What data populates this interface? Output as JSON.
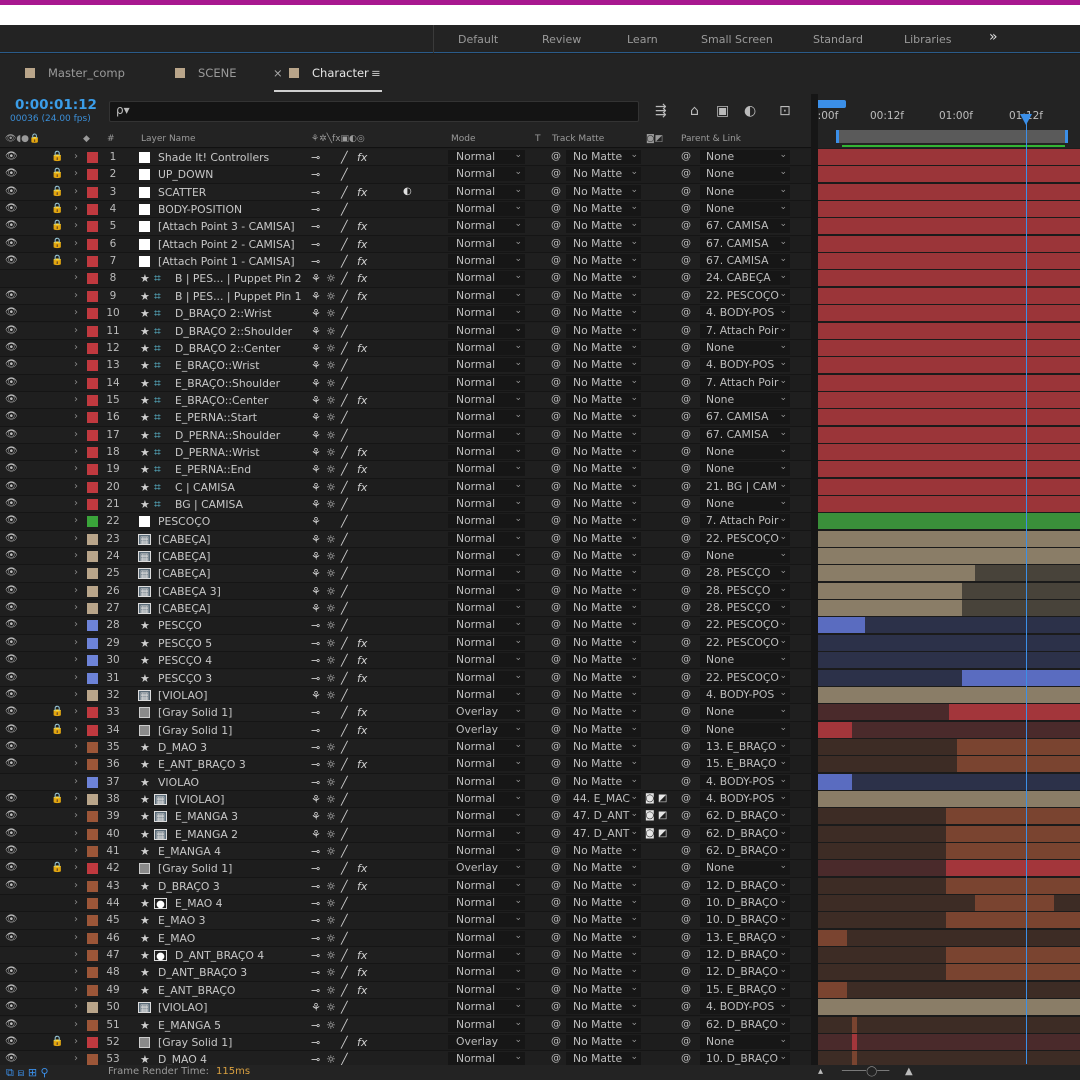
{
  "workspace": {
    "items": [
      "Default",
      "Review",
      "Learn",
      "Small Screen",
      "Standard",
      "Libraries"
    ],
    "more": "»"
  },
  "tabs": {
    "items": [
      "Master_comp",
      "SCENE",
      "Character"
    ],
    "close": "×",
    "menu": "≡"
  },
  "timeline": {
    "timecode": "0:00:01:12",
    "frames": "00036 (24.00 fps)",
    "search_icon": "ρ▾",
    "ruler": [
      "0:00f",
      "00:12f",
      "01:00f",
      "01:12f"
    ]
  },
  "headers": {
    "layer_name": "Layer Name",
    "mode": "Mode",
    "t": "T",
    "track_matte": "Track Matte",
    "parent": "Parent & Link",
    "num": "#"
  },
  "colors": {
    "red": "#c0393f",
    "green": "#3aa43a",
    "tan": "#b9a58a",
    "blue": "#6d83d8",
    "brown": "#9c5638",
    "gray": "#8a8a8a"
  },
  "layers": [
    {
      "n": "1",
      "name": "Shade It! Controllers",
      "src": "white",
      "lock": true,
      "label": "red",
      "fx": true,
      "mode": "Normal",
      "matte": "No Matte",
      "parent": "None"
    },
    {
      "n": "2",
      "name": "UP_DOWN",
      "src": "white",
      "lock": true,
      "label": "red",
      "fx": false,
      "mode": "Normal",
      "matte": "No Matte",
      "parent": "None"
    },
    {
      "n": "3",
      "name": "SCATTER",
      "src": "white",
      "lock": true,
      "label": "red",
      "fx": true,
      "mb": true,
      "mode": "Normal",
      "matte": "No Matte",
      "parent": "None"
    },
    {
      "n": "4",
      "name": "BODY-POSITION",
      "src": "white",
      "lock": true,
      "label": "red",
      "fx": false,
      "mode": "Normal",
      "matte": "No Matte",
      "parent": "None"
    },
    {
      "n": "5",
      "name": "[Attach Point 3 - CAMISA]",
      "src": "white",
      "lock": true,
      "label": "red",
      "fx": true,
      "mode": "Normal",
      "matte": "No Matte",
      "parent": "67. CAMISA"
    },
    {
      "n": "6",
      "name": "[Attach Point 2 - CAMISA]",
      "src": "white",
      "lock": true,
      "label": "red",
      "fx": true,
      "mode": "Normal",
      "matte": "No Matte",
      "parent": "67. CAMISA"
    },
    {
      "n": "7",
      "name": "[Attach Point 1 - CAMISA]",
      "src": "white",
      "lock": true,
      "label": "red",
      "fx": true,
      "mode": "Normal",
      "matte": "No Matte",
      "parent": "67. CAMISA"
    },
    {
      "n": "8",
      "name": "B | PES... | Puppet Pin 2",
      "src": "star",
      "hash": true,
      "label": "red",
      "fx": true,
      "eye": false,
      "mode": "Normal",
      "matte": "No Matte",
      "parent": "24. CABEÇA"
    },
    {
      "n": "9",
      "name": "B | PES... | Puppet Pin 1",
      "src": "star",
      "hash": true,
      "label": "red",
      "fx": true,
      "mode": "Normal",
      "matte": "No Matte",
      "parent": "22. PESCOÇO"
    },
    {
      "n": "10",
      "name": "D_BRAÇO 2::Wrist",
      "src": "star",
      "hash": true,
      "label": "red",
      "fx": false,
      "mode": "Normal",
      "matte": "No Matte",
      "parent": "4. BODY-POS"
    },
    {
      "n": "11",
      "name": "D_BRAÇO 2::Shoulder",
      "src": "star",
      "hash": true,
      "label": "red",
      "fx": false,
      "mode": "Normal",
      "matte": "No Matte",
      "parent": "7. Attach Poir"
    },
    {
      "n": "12",
      "name": "D_BRAÇO 2::Center",
      "src": "star",
      "hash": true,
      "label": "red",
      "fx": true,
      "mode": "Normal",
      "matte": "No Matte",
      "parent": "None"
    },
    {
      "n": "13",
      "name": "E_BRAÇO::Wrist",
      "src": "star",
      "hash": true,
      "label": "red",
      "fx": false,
      "mode": "Normal",
      "matte": "No Matte",
      "parent": "4. BODY-POS"
    },
    {
      "n": "14",
      "name": "E_BRAÇO::Shoulder",
      "src": "star",
      "hash": true,
      "label": "red",
      "fx": false,
      "mode": "Normal",
      "matte": "No Matte",
      "parent": "7. Attach Poir"
    },
    {
      "n": "15",
      "name": "E_BRAÇO::Center",
      "src": "star",
      "hash": true,
      "label": "red",
      "fx": true,
      "mode": "Normal",
      "matte": "No Matte",
      "parent": "None"
    },
    {
      "n": "16",
      "name": "E_PERNA::Start",
      "src": "star",
      "hash": true,
      "label": "red",
      "fx": false,
      "mode": "Normal",
      "matte": "No Matte",
      "parent": "67. CAMISA"
    },
    {
      "n": "17",
      "name": "D_PERNA::Shoulder",
      "src": "star",
      "hash": true,
      "label": "red",
      "fx": false,
      "mode": "Normal",
      "matte": "No Matte",
      "parent": "67. CAMISA"
    },
    {
      "n": "18",
      "name": "D_PERNA::Wrist",
      "src": "star",
      "hash": true,
      "label": "red",
      "fx": true,
      "mode": "Normal",
      "matte": "No Matte",
      "parent": "None"
    },
    {
      "n": "19",
      "name": "E_PERNA::End",
      "src": "star",
      "hash": true,
      "label": "red",
      "fx": true,
      "mode": "Normal",
      "matte": "No Matte",
      "parent": "None"
    },
    {
      "n": "20",
      "name": "C | CAMISA",
      "src": "star",
      "hash": true,
      "label": "red",
      "fx": true,
      "mode": "Normal",
      "matte": "No Matte",
      "parent": "21. BG | CAM"
    },
    {
      "n": "21",
      "name": "BG | CAMISA",
      "src": "star",
      "hash": true,
      "label": "red",
      "fx": false,
      "mode": "Normal",
      "matte": "No Matte",
      "parent": "None"
    },
    {
      "n": "22",
      "name": "PESCOÇO",
      "src": "white",
      "label": "green",
      "fx": false,
      "mode": "Normal",
      "matte": "No Matte",
      "parent": "7. Attach Poir"
    },
    {
      "n": "23",
      "name": "[CABEÇA]",
      "src": "comp",
      "label": "tan",
      "fx": false,
      "mode": "Normal",
      "matte": "No Matte",
      "parent": "22. PESCOÇO"
    },
    {
      "n": "24",
      "name": "[CABEÇA]",
      "src": "comp",
      "label": "tan",
      "fx": false,
      "mode": "Normal",
      "matte": "No Matte",
      "parent": "None"
    },
    {
      "n": "25",
      "name": "[CABEÇA]",
      "src": "comp",
      "label": "tan",
      "fx": false,
      "mode": "Normal",
      "matte": "No Matte",
      "parent": "28. PESCÇO"
    },
    {
      "n": "26",
      "name": "[CABEÇA 3]",
      "src": "comp",
      "label": "tan",
      "fx": false,
      "mode": "Normal",
      "matte": "No Matte",
      "parent": "28. PESCÇO"
    },
    {
      "n": "27",
      "name": "[CABEÇA]",
      "src": "comp",
      "label": "tan",
      "fx": false,
      "mode": "Normal",
      "matte": "No Matte",
      "parent": "28. PESCÇO"
    },
    {
      "n": "28",
      "name": "PESCÇO",
      "src": "star",
      "label": "blue",
      "fx": false,
      "mode": "Normal",
      "matte": "No Matte",
      "parent": "22. PESCOÇO"
    },
    {
      "n": "29",
      "name": "PESCÇO 5",
      "src": "star",
      "label": "blue",
      "fx": true,
      "mode": "Normal",
      "matte": "No Matte",
      "parent": "22. PESCOÇO"
    },
    {
      "n": "30",
      "name": "PESCÇO 4",
      "src": "star",
      "label": "blue",
      "fx": true,
      "mode": "Normal",
      "matte": "No Matte",
      "parent": "None"
    },
    {
      "n": "31",
      "name": "PESCÇO 3",
      "src": "star",
      "label": "blue",
      "fx": true,
      "mode": "Normal",
      "matte": "No Matte",
      "parent": "22. PESCOÇO"
    },
    {
      "n": "32",
      "name": "[VIOLAO]",
      "src": "comp",
      "label": "tan",
      "fx": false,
      "mode": "Normal",
      "matte": "No Matte",
      "parent": "4. BODY-POS"
    },
    {
      "n": "33",
      "name": "[Gray Solid 1]",
      "src": "gray",
      "lock": true,
      "label": "red",
      "fx": true,
      "mode": "Overlay",
      "matte": "No Matte",
      "parent": "None"
    },
    {
      "n": "34",
      "name": "[Gray Solid 1]",
      "src": "gray",
      "lock": true,
      "label": "red",
      "fx": true,
      "mode": "Overlay",
      "matte": "No Matte",
      "parent": "None"
    },
    {
      "n": "35",
      "name": "D_MAO 3",
      "src": "star",
      "label": "brown",
      "fx": false,
      "mode": "Normal",
      "matte": "No Matte",
      "parent": "13. E_BRAÇO"
    },
    {
      "n": "36",
      "name": "E_ANT_BRAÇO 3",
      "src": "star",
      "label": "brown",
      "fx": true,
      "mode": "Normal",
      "matte": "No Matte",
      "parent": "15. E_BRAÇO"
    },
    {
      "n": "37",
      "name": "VIOLAO",
      "src": "star",
      "label": "blue",
      "fx": false,
      "eye": false,
      "mode": "Normal",
      "matte": "No Matte",
      "parent": "4. BODY-POS"
    },
    {
      "n": "38",
      "name": "[VIOLAO]",
      "src": "comp",
      "indent": true,
      "lock": true,
      "label": "tan",
      "fx": false,
      "mode": "Normal",
      "matte": "44. E_MAC",
      "tmx": true,
      "parent": "4. BODY-POS"
    },
    {
      "n": "39",
      "name": "E_MANGA 3",
      "src": "comp",
      "indent": true,
      "label": "brown",
      "fx": false,
      "mode": "Normal",
      "matte": "47. D_ANT",
      "tmx": true,
      "parent": "62. D_BRAÇO"
    },
    {
      "n": "40",
      "name": "E_MANGA 2",
      "src": "comp",
      "indent": true,
      "label": "brown",
      "fx": false,
      "mode": "Normal",
      "matte": "47. D_ANT",
      "tmx": true,
      "parent": "62. D_BRAÇO"
    },
    {
      "n": "41",
      "name": "E_MANGA 4",
      "src": "star",
      "label": "brown",
      "fx": false,
      "mode": "Normal",
      "matte": "No Matte",
      "parent": "62. D_BRAÇO"
    },
    {
      "n": "42",
      "name": "[Gray Solid 1]",
      "src": "gray",
      "lock": true,
      "label": "red",
      "fx": true,
      "mode": "Overlay",
      "matte": "No Matte",
      "parent": "None"
    },
    {
      "n": "43",
      "name": "D_BRAÇO 3",
      "src": "star",
      "label": "brown",
      "fx": true,
      "mode": "Normal",
      "matte": "No Matte",
      "parent": "12. D_BRAÇO"
    },
    {
      "n": "44",
      "name": "E_MAO 4",
      "src": "target",
      "indent": true,
      "label": "brown",
      "fx": false,
      "eye": false,
      "mode": "Normal",
      "matte": "No Matte",
      "parent": "10. D_BRAÇO"
    },
    {
      "n": "45",
      "name": "E_MAO 3",
      "src": "star",
      "label": "brown",
      "fx": false,
      "mode": "Normal",
      "matte": "No Matte",
      "parent": "10. D_BRAÇO"
    },
    {
      "n": "46",
      "name": "E_MAO",
      "src": "star",
      "label": "brown",
      "fx": false,
      "mode": "Normal",
      "matte": "No Matte",
      "parent": "13. E_BRAÇO"
    },
    {
      "n": "47",
      "name": "D_ANT_BRAÇO 4",
      "src": "target",
      "indent": true,
      "label": "brown",
      "fx": true,
      "eye": false,
      "mode": "Normal",
      "matte": "No Matte",
      "parent": "12. D_BRAÇO"
    },
    {
      "n": "48",
      "name": "D_ANT_BRAÇO 3",
      "src": "star",
      "label": "brown",
      "fx": true,
      "mode": "Normal",
      "matte": "No Matte",
      "parent": "12. D_BRAÇO"
    },
    {
      "n": "49",
      "name": "E_ANT_BRAÇO",
      "src": "star",
      "label": "brown",
      "fx": true,
      "mode": "Normal",
      "matte": "No Matte",
      "parent": "15. E_BRAÇO"
    },
    {
      "n": "50",
      "name": "[VIOLAO]",
      "src": "comp",
      "label": "tan",
      "fx": false,
      "mode": "Normal",
      "matte": "No Matte",
      "parent": "4. BODY-POS"
    },
    {
      "n": "51",
      "name": "E_MANGA 5",
      "src": "star",
      "label": "brown",
      "fx": false,
      "mode": "Normal",
      "matte": "No Matte",
      "parent": "62. D_BRAÇO"
    },
    {
      "n": "52",
      "name": "[Gray Solid 1]",
      "src": "gray",
      "lock": true,
      "label": "red",
      "fx": true,
      "mode": "Overlay",
      "matte": "No Matte",
      "parent": "None"
    },
    {
      "n": "53",
      "name": "D_MAO 4",
      "src": "star",
      "label": "brown",
      "fx": false,
      "mode": "Normal",
      "matte": "No Matte",
      "parent": "10. D_BRAÇO"
    }
  ],
  "status": {
    "label": "Frame Render Time:",
    "value": "115ms"
  }
}
